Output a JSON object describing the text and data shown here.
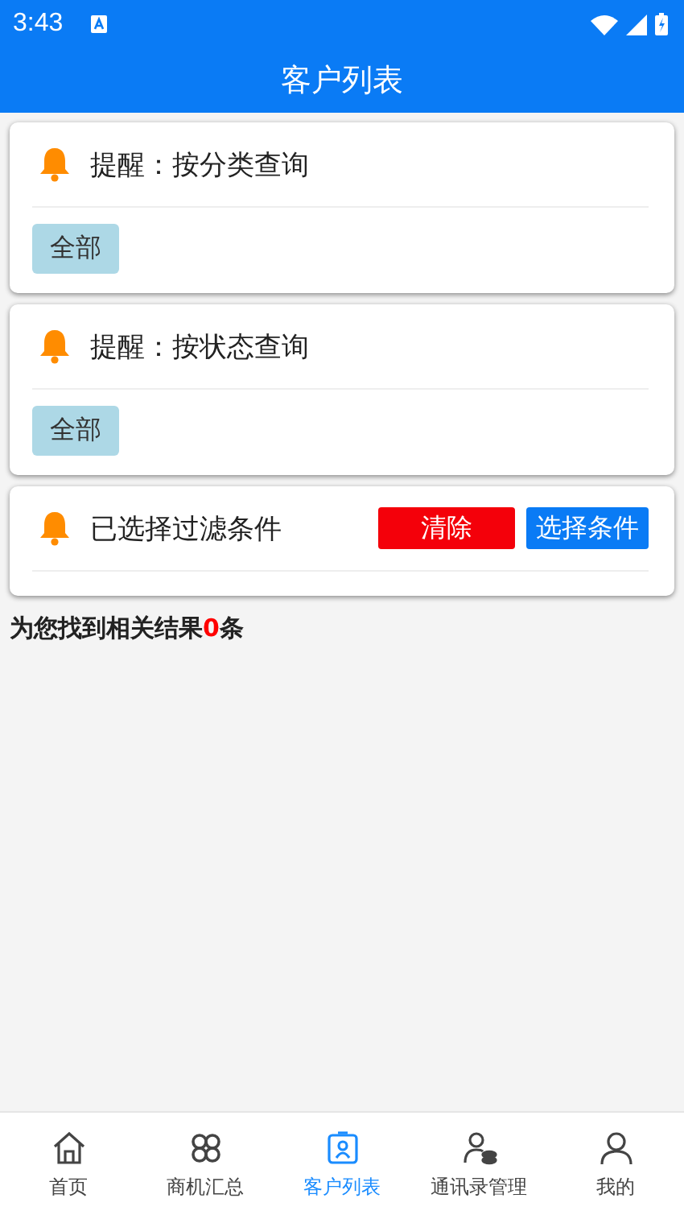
{
  "status_bar": {
    "time": "3:43"
  },
  "header": {
    "title": "客户列表"
  },
  "filter_cards": [
    {
      "title": "提醒：按分类查询",
      "options": [
        {
          "label": "全部",
          "selected": true
        }
      ]
    },
    {
      "title": "提醒：按状态查询",
      "options": [
        {
          "label": "全部",
          "selected": true
        }
      ]
    }
  ],
  "selected_filters": {
    "title": "已选择过滤条件",
    "clear_button": "清除",
    "choose_button": "选择条件"
  },
  "result": {
    "prefix": "为您找到相关结果",
    "count": "0",
    "suffix": "条"
  },
  "bottom_nav": [
    {
      "label": "首页",
      "selected": false
    },
    {
      "label": "商机汇总",
      "selected": false
    },
    {
      "label": "客户列表",
      "selected": true
    },
    {
      "label": "通讯录管理",
      "selected": false
    },
    {
      "label": "我的",
      "selected": false
    }
  ]
}
